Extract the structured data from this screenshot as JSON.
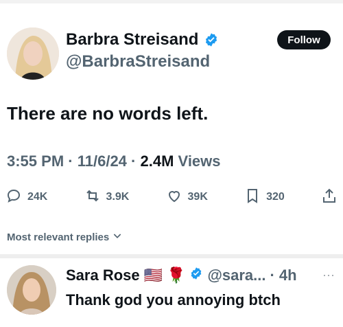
{
  "tweet": {
    "author_name": "Barbra Streisand",
    "author_handle": "@BarbraStreisand",
    "follow_label": "Follow",
    "text": "There are no words left.",
    "time": "3:55 PM",
    "date": "11/6/24",
    "views_count": "2.4M",
    "views_label": "Views",
    "replies": "24K",
    "reposts": "3.9K",
    "likes": "39K",
    "bookmarks": "320"
  },
  "replies_sort": "Most relevant replies",
  "reply": {
    "name": "Sara Rose",
    "flag_emoji": "🇺🇸",
    "rose_emoji": "🌹",
    "handle": "@sara...",
    "time": "4h",
    "text": "Thank god you annoying btch"
  },
  "colors": {
    "verified_blue": "#1d9bf0",
    "text_primary": "#0f1419",
    "text_secondary": "#536471",
    "follow_bg": "#0f1419"
  }
}
